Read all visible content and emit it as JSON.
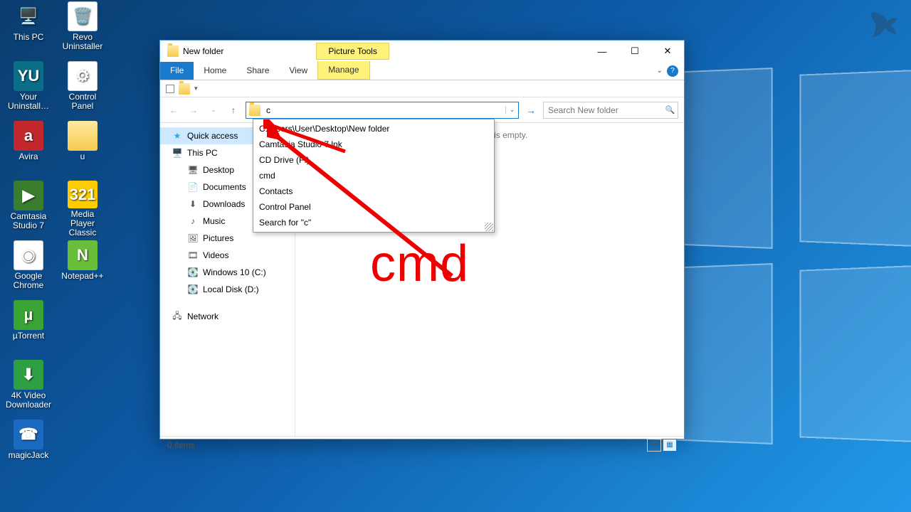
{
  "desktop_icons": [
    {
      "label": "This PC",
      "icon": "🖥️",
      "bg": ""
    },
    {
      "label": "Revo Uninstaller",
      "icon": "🗑️",
      "bg": "bg-white"
    },
    {
      "label": "Your Uninstall…",
      "icon": "YU",
      "bg": "bg-teal"
    },
    {
      "label": "Control Panel",
      "icon": "⚙",
      "bg": "bg-white"
    },
    {
      "label": "Avira",
      "icon": "a",
      "bg": "bg-red"
    },
    {
      "label": "u",
      "icon": "",
      "bg": "bg-folder"
    },
    {
      "label": "Camtasia Studio 7",
      "icon": "▶",
      "bg": "bg-green"
    },
    {
      "label": "Media Player Classic",
      "icon": "321",
      "bg": "bg-yellow"
    },
    {
      "label": "Google Chrome",
      "icon": "◉",
      "bg": "bg-white"
    },
    {
      "label": "Notepad++",
      "icon": "N",
      "bg": "bg-lime"
    },
    {
      "label": "µTorrent",
      "icon": "µ",
      "bg": "bg-utg"
    },
    {
      "label": "",
      "icon": "",
      "bg": ""
    },
    {
      "label": "4K Video Downloader",
      "icon": "⬇",
      "bg": "bg-4k"
    },
    {
      "label": "",
      "icon": "",
      "bg": ""
    },
    {
      "label": "magicJack",
      "icon": "☎",
      "bg": "bg-blue"
    }
  ],
  "window": {
    "title": "New folder",
    "context_tab": "Picture Tools",
    "ribbon": {
      "file": "File",
      "home": "Home",
      "share": "Share",
      "view": "View",
      "manage": "Manage"
    },
    "address_value": "c",
    "search_placeholder": "Search New folder",
    "empty_text": "This folder is empty.",
    "status": "0 items"
  },
  "sidebar": [
    {
      "label": "Quick access",
      "type": "head",
      "icon": "★",
      "active": true,
      "color": "#2fa8e0"
    },
    {
      "label": "This PC",
      "type": "head",
      "icon": "🖥️"
    },
    {
      "label": "Desktop",
      "type": "child",
      "icon": "🖥"
    },
    {
      "label": "Documents",
      "type": "child",
      "icon": "📄"
    },
    {
      "label": "Downloads",
      "type": "child",
      "icon": "⬇"
    },
    {
      "label": "Music",
      "type": "child",
      "icon": "♪"
    },
    {
      "label": "Pictures",
      "type": "child",
      "icon": "🖼"
    },
    {
      "label": "Videos",
      "type": "child",
      "icon": "🎞"
    },
    {
      "label": "Windows 10 (C:)",
      "type": "child",
      "icon": "💽"
    },
    {
      "label": "Local Disk (D:)",
      "type": "child",
      "icon": "💽"
    },
    {
      "label": "Network",
      "type": "head",
      "icon": "🖧",
      "gap": true
    }
  ],
  "autocomplete": [
    "C:\\Users\\User\\Desktop\\New folder",
    "Camtasia Studio 7.lnk",
    "CD Drive (F:)",
    "cmd",
    "Contacts",
    "Control Panel",
    "Search for \"c\""
  ],
  "annotation_text": "cmd"
}
